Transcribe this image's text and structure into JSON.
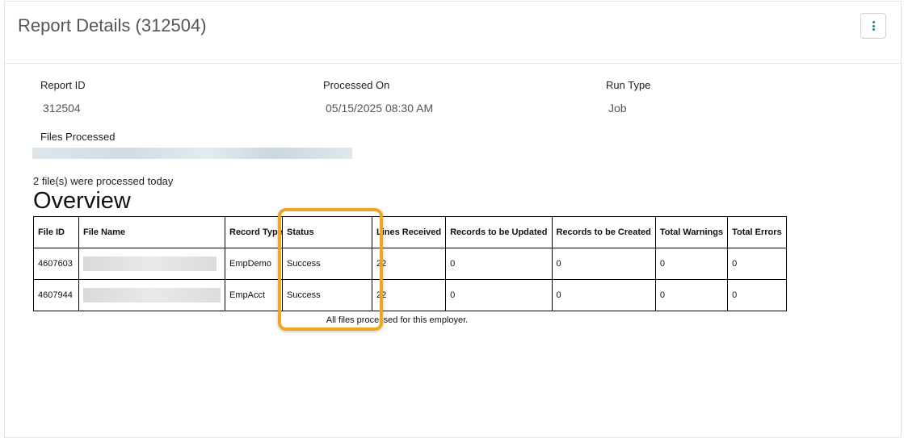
{
  "header": {
    "title": "Report Details (312504)"
  },
  "details": {
    "report_id_label": "Report ID",
    "report_id_value": "312504",
    "processed_on_label": "Processed On",
    "processed_on_value": "05/15/2025 08:30 AM",
    "run_type_label": "Run Type",
    "run_type_value": "Job",
    "files_processed_label": "Files Processed"
  },
  "summary": {
    "count_text": "2 file(s) were processed today",
    "overview_heading": "Overview"
  },
  "table": {
    "headers": [
      "File ID",
      "File Name",
      "Record Type",
      "Status",
      "Lines Received",
      "Records to be Updated",
      "Records to be Created",
      "Total Warnings",
      "Total Errors"
    ],
    "rows": [
      {
        "file_id": "4607603",
        "record_type": "EmpDemo",
        "status": "Success",
        "lines_received": "22",
        "to_update": "0",
        "to_create": "0",
        "warnings": "0",
        "errors": "0"
      },
      {
        "file_id": "4607944",
        "record_type": "EmpAcct",
        "status": "Success",
        "lines_received": "22",
        "to_update": "0",
        "to_create": "0",
        "warnings": "0",
        "errors": "0"
      }
    ],
    "footer_note": "All files processed for this employer."
  },
  "colors": {
    "highlight": "#f0a523",
    "menu_dots": "#1f7a8c"
  },
  "icons": {
    "menu": "vertical-ellipsis-icon"
  }
}
